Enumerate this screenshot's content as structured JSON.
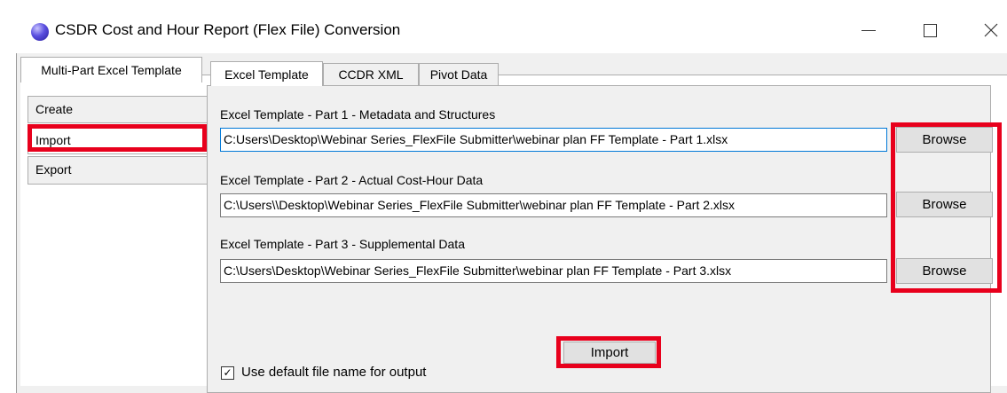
{
  "window": {
    "title": "CSDR Cost and Hour Report (Flex File) Conversion",
    "icon": "globe-icon",
    "controls": {
      "minimize": "—",
      "maximize": "☐",
      "close": "✕"
    }
  },
  "outer_tabs": [
    {
      "label": "Multi-Part Excel Template",
      "active": true
    }
  ],
  "side_menu": [
    {
      "label": "Create",
      "selected": false
    },
    {
      "label": "Import",
      "selected": true
    },
    {
      "label": "Export",
      "selected": false
    }
  ],
  "inner_tabs": [
    {
      "label": "Excel Template",
      "active": true
    },
    {
      "label": "CCDR XML",
      "active": false
    },
    {
      "label": "Pivot Data",
      "active": false
    }
  ],
  "parts": [
    {
      "label": "Excel Template - Part 1 - Metadata and Structures",
      "path": "C:Users\\Desktop\\Webinar Series_FlexFile Submitter\\webinar plan FF Template - Part 1.xlsx",
      "browse": "Browse"
    },
    {
      "label": "Excel Template - Part 2 - Actual Cost-Hour Data",
      "path": "C:\\Users\\\\Desktop\\Webinar Series_FlexFile Submitter\\webinar plan FF Template - Part 2.xlsx",
      "browse": "Browse"
    },
    {
      "label": "Excel Template - Part 3 - Supplemental Data",
      "path": "C:\\Users\\Desktop\\Webinar Series_FlexFile Submitter\\webinar plan FF Template - Part 3.xlsx",
      "browse": "Browse"
    }
  ],
  "import_button": "Import",
  "default_name_checkbox": {
    "label": "Use default file name for output",
    "checked": true,
    "mark": "✓"
  },
  "colors": {
    "highlight": "#e8001c",
    "focus_border": "#0078d7"
  }
}
